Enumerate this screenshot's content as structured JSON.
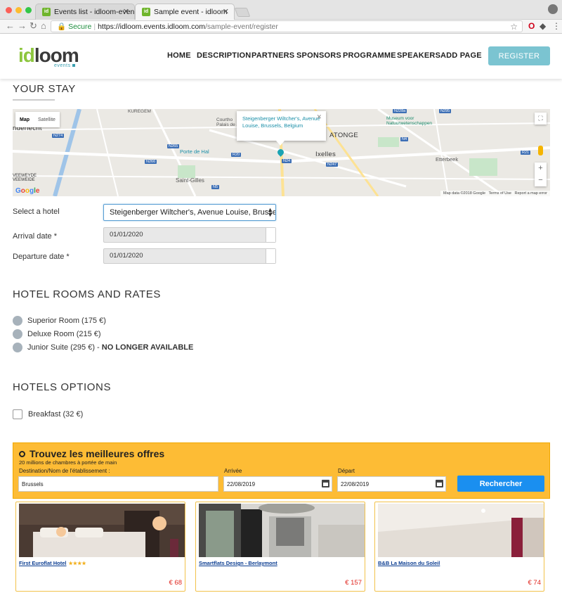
{
  "browser": {
    "tabs": [
      {
        "title": "Events list - idloom-events",
        "active": false
      },
      {
        "title": "Sample event - idloom",
        "active": true
      }
    ],
    "url": {
      "secure_label": "Secure",
      "host": "https://idloom.events.idloom.com",
      "path": "/sample-event/register"
    }
  },
  "header": {
    "logo_main": "idloom",
    "logo_sub": "events",
    "nav": [
      "HOME",
      "DESCRIPTION",
      "PARTNERS",
      "SPONSORS",
      "PROGRAMME",
      "SPEAKERS",
      "ADD PAGE"
    ],
    "register_label": "REGISTER"
  },
  "stay": {
    "title": "YOUR STAY",
    "map": {
      "type_map": "Map",
      "type_satellite": "Satellite",
      "popup_text": "Steigenberger Wiltcher's, Avenue Louise, Brussels, Belgium",
      "labels": {
        "kuregem": "KUREGEM",
        "anderlecht": "nderlecht",
        "courthouse": "Courtho Palais de Ju",
        "atonge": "ATONGE",
        "museum": "Museum voor Natuurwetenschappen",
        "porte_de_hal": "Porte de Hal",
        "ixelles": "Ixelles",
        "etterbeek": "Etterbeek",
        "saint_gilles": "Saint-Gilles",
        "veeweyde": "VEEWEYDE VEEWEIDE"
      },
      "roads": [
        "N274",
        "N265",
        "N266",
        "R20",
        "N24",
        "N247",
        "N5",
        "N295",
        "N228a",
        "N4",
        "R21"
      ],
      "footer": [
        "Map data ©2018 Google",
        "Terms of Use",
        "Report a map error"
      ],
      "google": "Google"
    },
    "hotel_label": "Select a hotel",
    "hotel_value": "Steigenberger Wiltcher's, Avenue Louise, Brussels, B",
    "arrival_label": "Arrival date *",
    "arrival_value": "01/01/2020",
    "departure_label": "Departure date *",
    "departure_value": "01/01/2020"
  },
  "rooms": {
    "title": "HOTEL ROOMS AND RATES",
    "options": [
      {
        "label": "Superior Room (175 €)",
        "note": ""
      },
      {
        "label": "Deluxe Room (215 €)",
        "note": ""
      },
      {
        "label": "Junior Suite (295 €) - ",
        "note": "NO LONGER AVAILABLE"
      }
    ]
  },
  "options": {
    "title": "HOTELS OPTIONS",
    "breakfast": "Breakfast (32 €)"
  },
  "booking": {
    "title": "Trouvez les meilleures offres",
    "subtitle": "20 millions de chambres à portée de main",
    "destination_label": "Destination/Nom de l'établissement :",
    "destination_value": "Brussels",
    "arrival_label": "Arrivée",
    "arrival_value": "22/08/2019",
    "departure_label": "Départ",
    "departure_value": "22/08/2019",
    "search_label": "Rechercher",
    "accent": "#fdbc35",
    "button_color": "#1a8ff0"
  },
  "hotels": [
    {
      "name": "First Euroflat Hotel",
      "stars": "★★★★",
      "price": "€ 68"
    },
    {
      "name": "Smartflats Design - Berlaymont",
      "stars": "",
      "price": "€ 157"
    },
    {
      "name": "B&B La Maison du Soleil",
      "stars": "",
      "price": "€ 74"
    }
  ]
}
